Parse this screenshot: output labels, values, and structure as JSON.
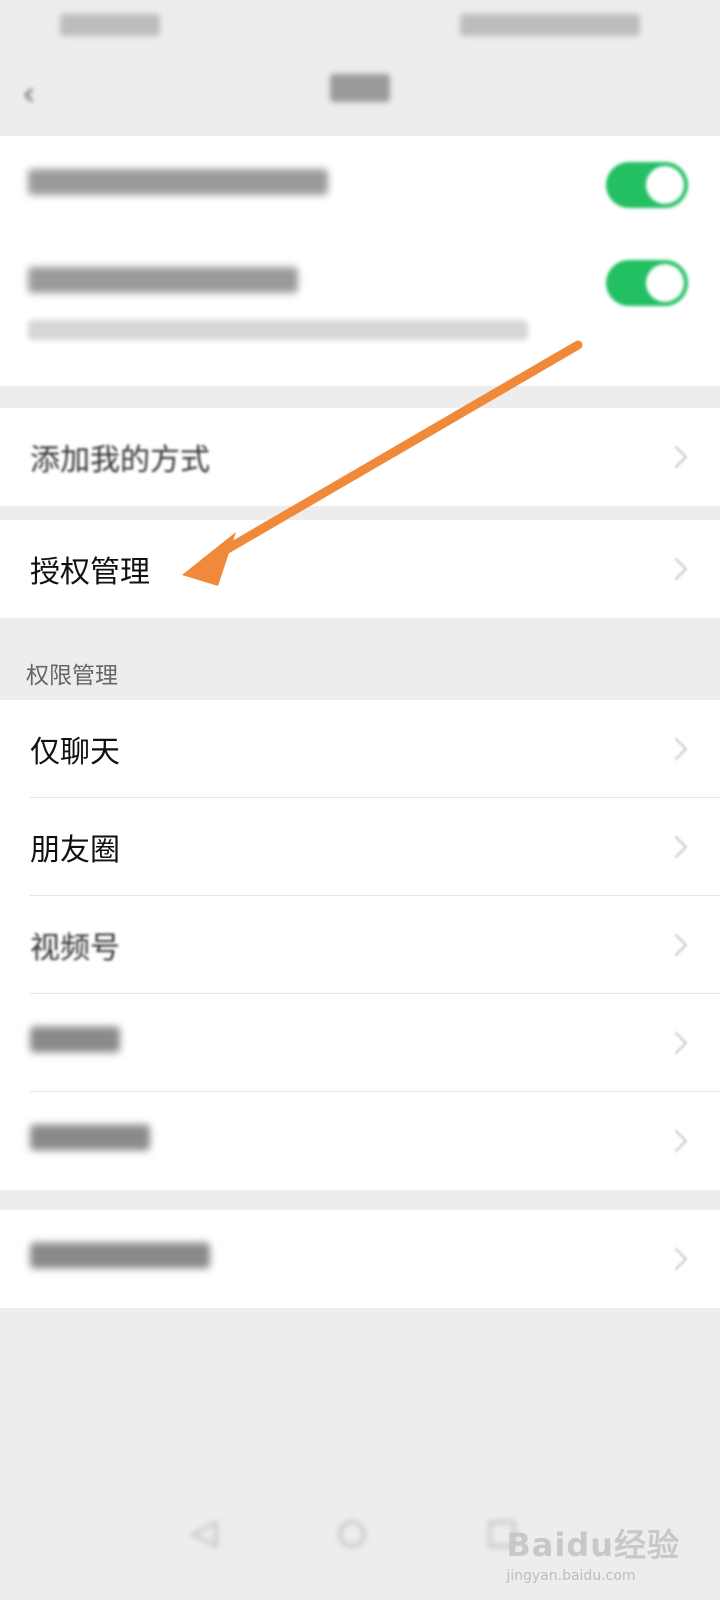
{
  "status_bar": {
    "left": "",
    "right": ""
  },
  "nav": {
    "title": ""
  },
  "privacy_toggles": [
    {
      "label": "",
      "enabled": true
    },
    {
      "label": "",
      "enabled": true
    }
  ],
  "toggle_caption": "",
  "menu": {
    "add_me_ways": "添加我的方式",
    "authorization": "授权管理"
  },
  "permissions": {
    "header": "权限管理",
    "items": [
      "仅聊天",
      "朋友圈",
      "视频号",
      "",
      ""
    ]
  },
  "extra_item": "",
  "watermark": {
    "brand": "Baidu经验",
    "url": "jingyan.baidu.com"
  },
  "colors": {
    "toggle_on": "#22c063",
    "arrow": "#f08a3a",
    "background": "#ededed"
  }
}
